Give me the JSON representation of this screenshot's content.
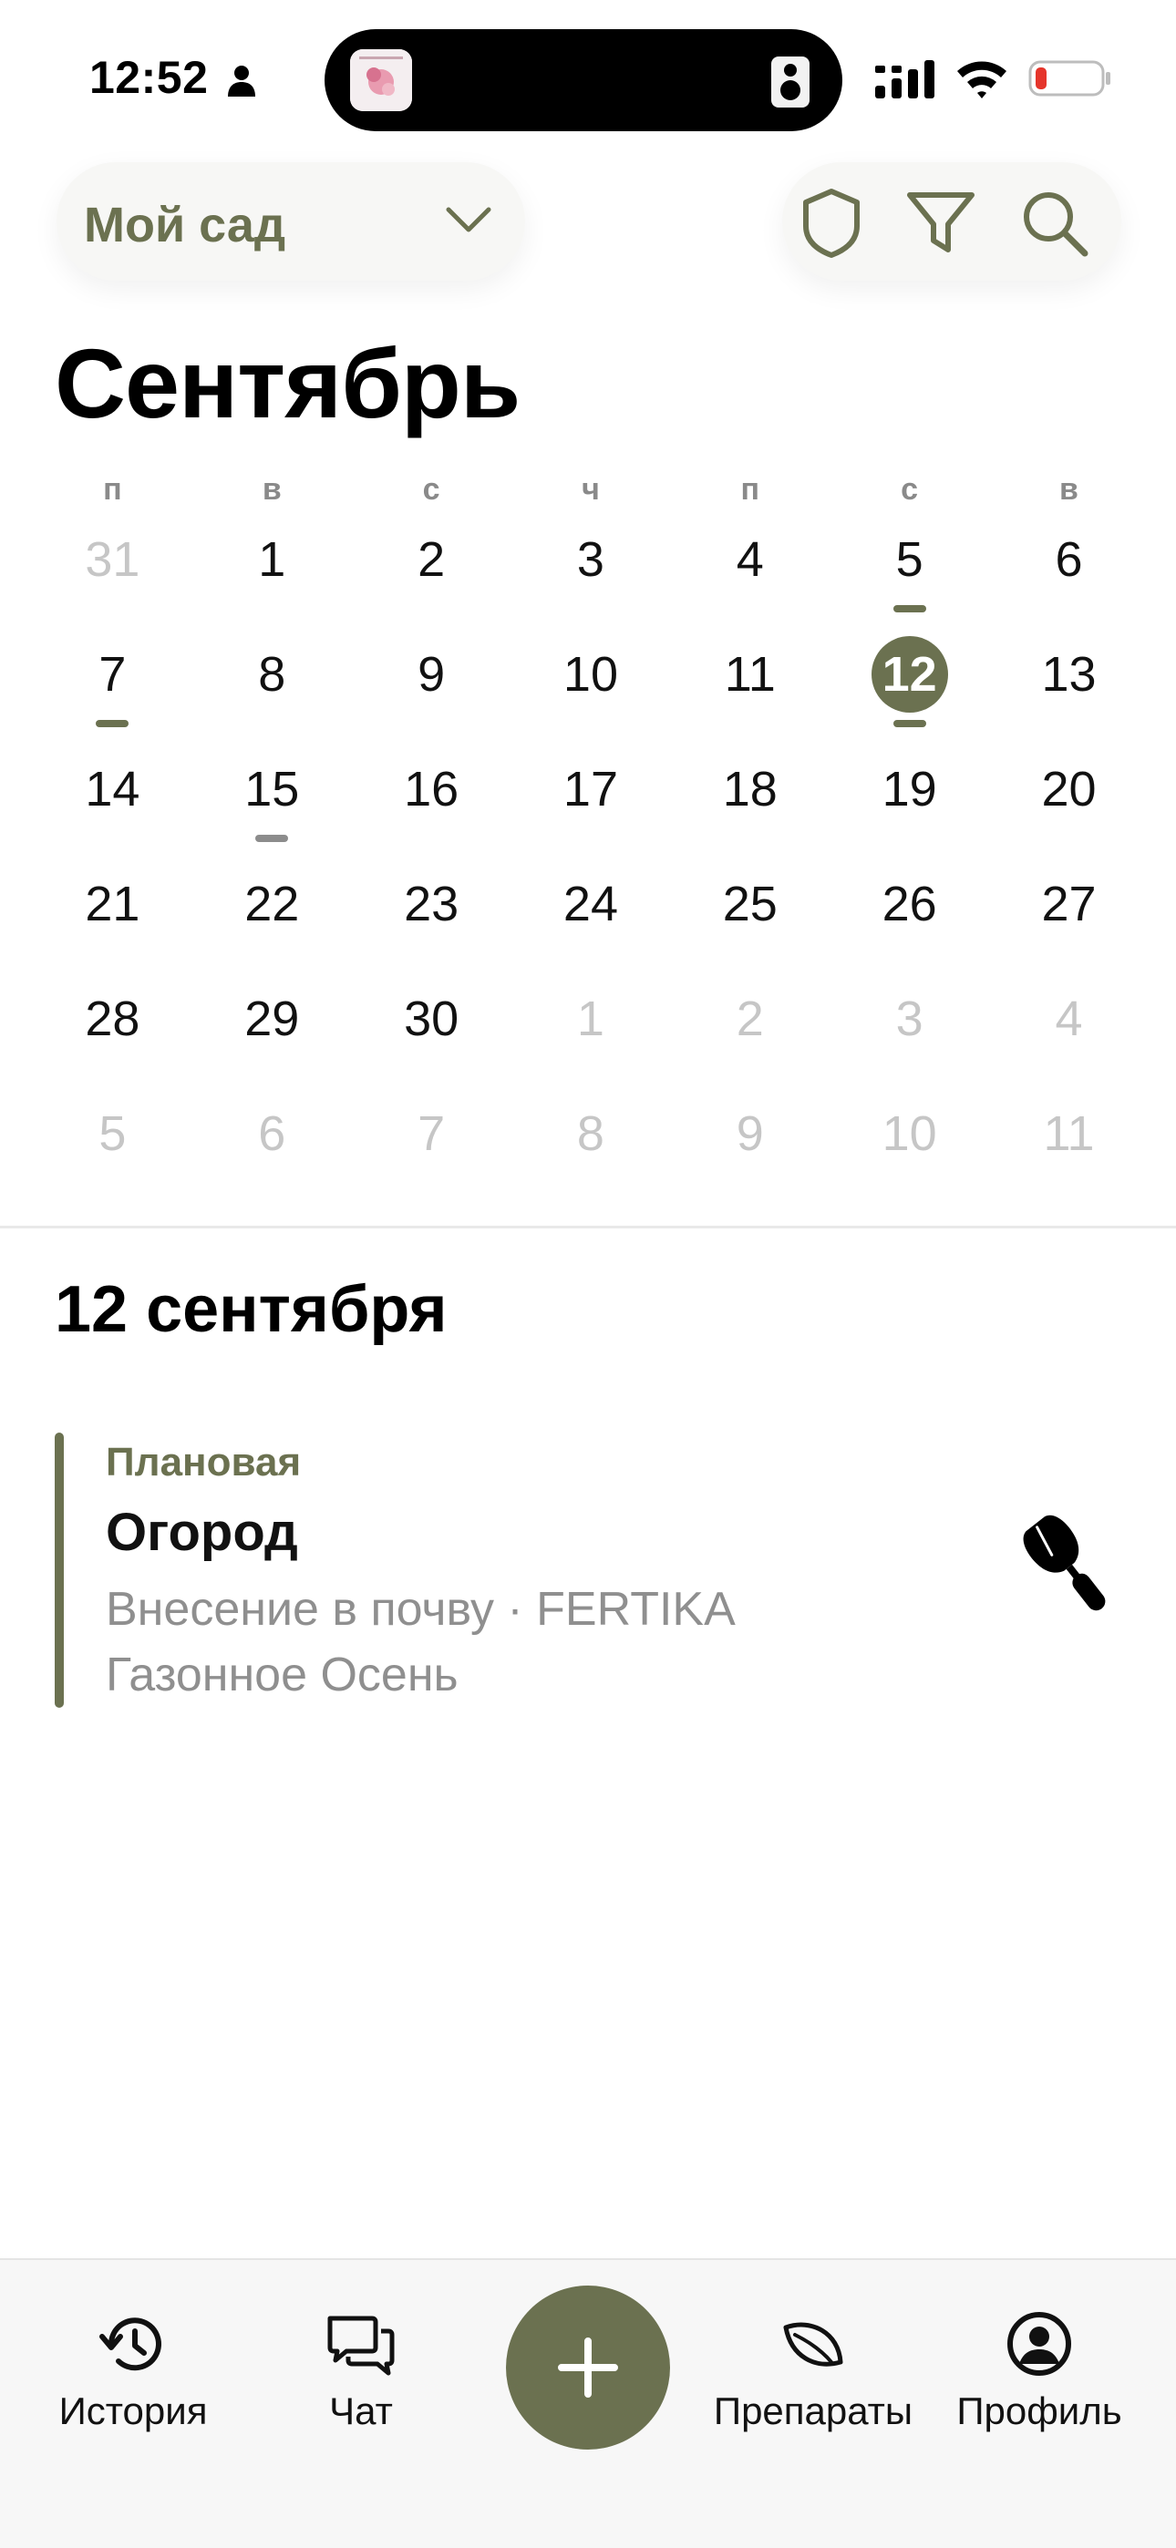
{
  "status_bar": {
    "time": "12:52"
  },
  "header": {
    "garden_name": "Мой сад",
    "icons": [
      "shield-icon",
      "filter-icon",
      "search-icon"
    ]
  },
  "calendar": {
    "month": "Сентябрь",
    "weekdays": [
      "п",
      "в",
      "с",
      "ч",
      "п",
      "с",
      "в"
    ],
    "weeks": [
      [
        "31",
        "1",
        "2",
        "3",
        "4",
        "5",
        "6"
      ],
      [
        "7",
        "8",
        "9",
        "10",
        "11",
        "12",
        "13"
      ],
      [
        "14",
        "15",
        "16",
        "17",
        "18",
        "19",
        "20"
      ],
      [
        "21",
        "22",
        "23",
        "24",
        "25",
        "26",
        "27"
      ],
      [
        "28",
        "29",
        "30",
        "1",
        "2",
        "3",
        "4"
      ],
      [
        "5",
        "6",
        "7",
        "8",
        "9",
        "10",
        "11"
      ]
    ],
    "selected_day": "12"
  },
  "day_view": {
    "title": "12 сентября",
    "events": [
      {
        "type": "Плановая",
        "title": "Огород",
        "description": "Внесение в почву · FERTIKA Газонное Осень",
        "icon": "trowel-icon"
      }
    ]
  },
  "tab_bar": {
    "history": "История",
    "chat": "Чат",
    "drugs": "Препараты",
    "profile": "Профиль"
  },
  "colors": {
    "accent": "#6b7150",
    "muted_text": "#8f8f8f",
    "weekday_text": "#8a8a8a",
    "other_month": "#c6c6c6"
  }
}
